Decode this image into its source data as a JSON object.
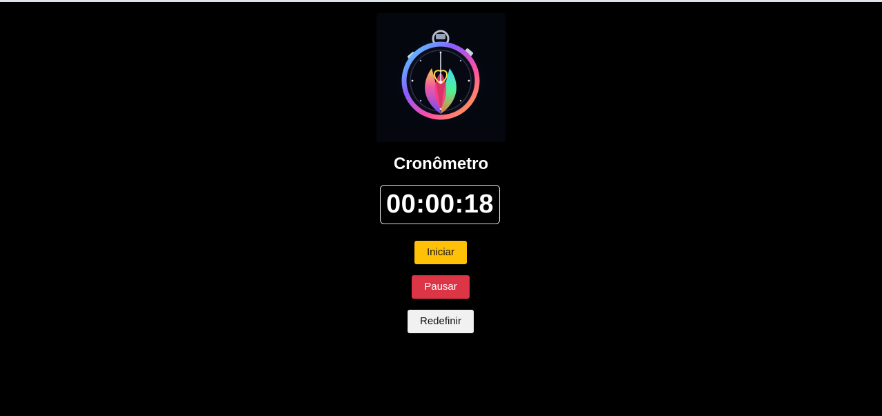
{
  "app": {
    "title": "Cronômetro"
  },
  "timer": {
    "display": "00:00:18"
  },
  "buttons": {
    "start_label": "Iniciar",
    "pause_label": "Pausar",
    "reset_label": "Redefinir"
  },
  "colors": {
    "background": "#000000",
    "start": "#ffc107",
    "pause": "#dc3545",
    "reset": "#f1f1f1",
    "timer_border": "#d9d9d9"
  },
  "icons": {
    "logo": "stopwatch-icon"
  }
}
